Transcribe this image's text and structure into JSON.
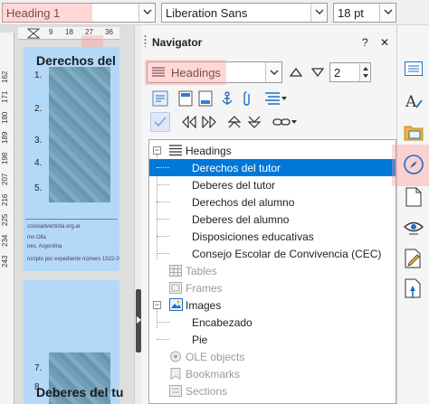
{
  "toolbar": {
    "paragraph_style": "Heading 1",
    "font_name": "Liberation Sans",
    "font_size": "18 pt"
  },
  "document": {
    "hruler_ticks": [
      "9",
      "18",
      "27",
      "36"
    ],
    "vruler_ticks": [
      "162",
      "171",
      "180",
      "189",
      "198",
      "207",
      "216",
      "225",
      "234",
      "243"
    ],
    "page1_heading": "Derechos del",
    "page1_numbers": [
      "1.",
      "2.",
      "3.",
      "4.",
      "5."
    ],
    "footer_lines": [
      "ccionadventista.org.ar",
      "mo Olla",
      "ires, Argentina",
      "ncripto por expediente número 1522-0"
    ],
    "page2_numbers": [
      "7.",
      "8."
    ],
    "page2_heading": "Deberes del tu"
  },
  "navigator": {
    "title": "Navigator",
    "help_label": "?",
    "close_label": "✕",
    "content_type": "Headings",
    "heading_level": "2",
    "tree": {
      "headings": {
        "label": "Headings",
        "items": [
          "Derechos del tutor",
          "Deberes del tutor",
          "Derechos del alumno",
          "Deberes del alumno",
          "Disposiciones educativas",
          "Consejo Escolar de Convivencia (CEC)"
        ],
        "selected_index": 0
      },
      "tables": "Tables",
      "frames": "Frames",
      "images": {
        "label": "Images",
        "items": [
          "Encabezado",
          "Pie"
        ]
      },
      "ole_objects": "OLE objects",
      "bookmarks": "Bookmarks",
      "sections": "Sections"
    }
  },
  "colors": {
    "selection": "#0078d7",
    "highlight": "#ff9a9a",
    "page": "#b4d8f8"
  }
}
